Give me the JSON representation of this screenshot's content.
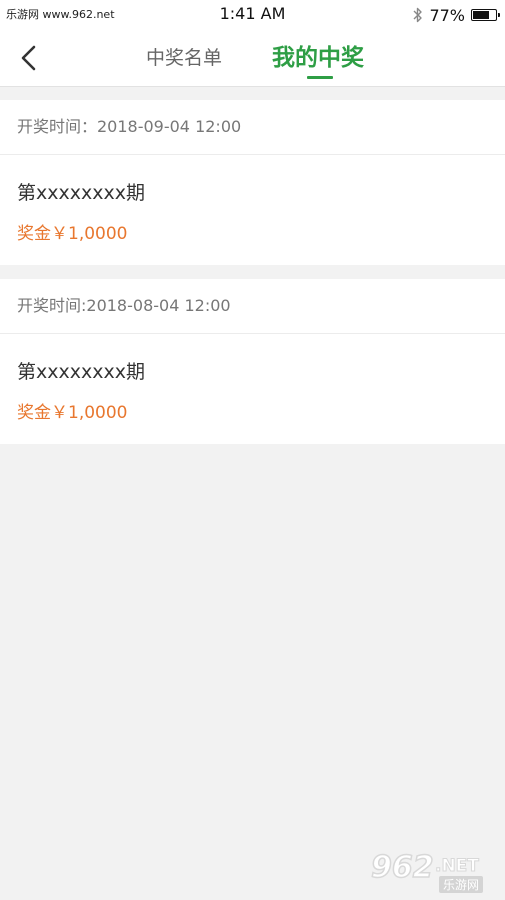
{
  "status_bar": {
    "carrier": "乐游网 www.962.net",
    "time": "1:41 AM",
    "battery_percent_text": "77%",
    "battery_level": 0.77,
    "bluetooth_icon": "bluetooth-icon"
  },
  "nav": {
    "back_icon": "chevron-left-icon",
    "tabs": [
      {
        "label": "中奖名单",
        "active": false
      },
      {
        "label": "我的中奖",
        "active": true
      }
    ],
    "active_color": "#2e9e45"
  },
  "records": [
    {
      "draw_time": "开奖时间：2018-09-04 12:00",
      "period": "第xxxxxxxx期",
      "prize": "奖金￥1,0000"
    },
    {
      "draw_time": "开奖时间:2018-08-04 12:00",
      "period": "第xxxxxxxx期",
      "prize": "奖金￥1,0000"
    }
  ],
  "colors": {
    "prize": "#e8772f",
    "background": "#f2f2f2"
  },
  "watermark": {
    "number": "962",
    "suffix": ".NET",
    "text": "乐游网"
  }
}
